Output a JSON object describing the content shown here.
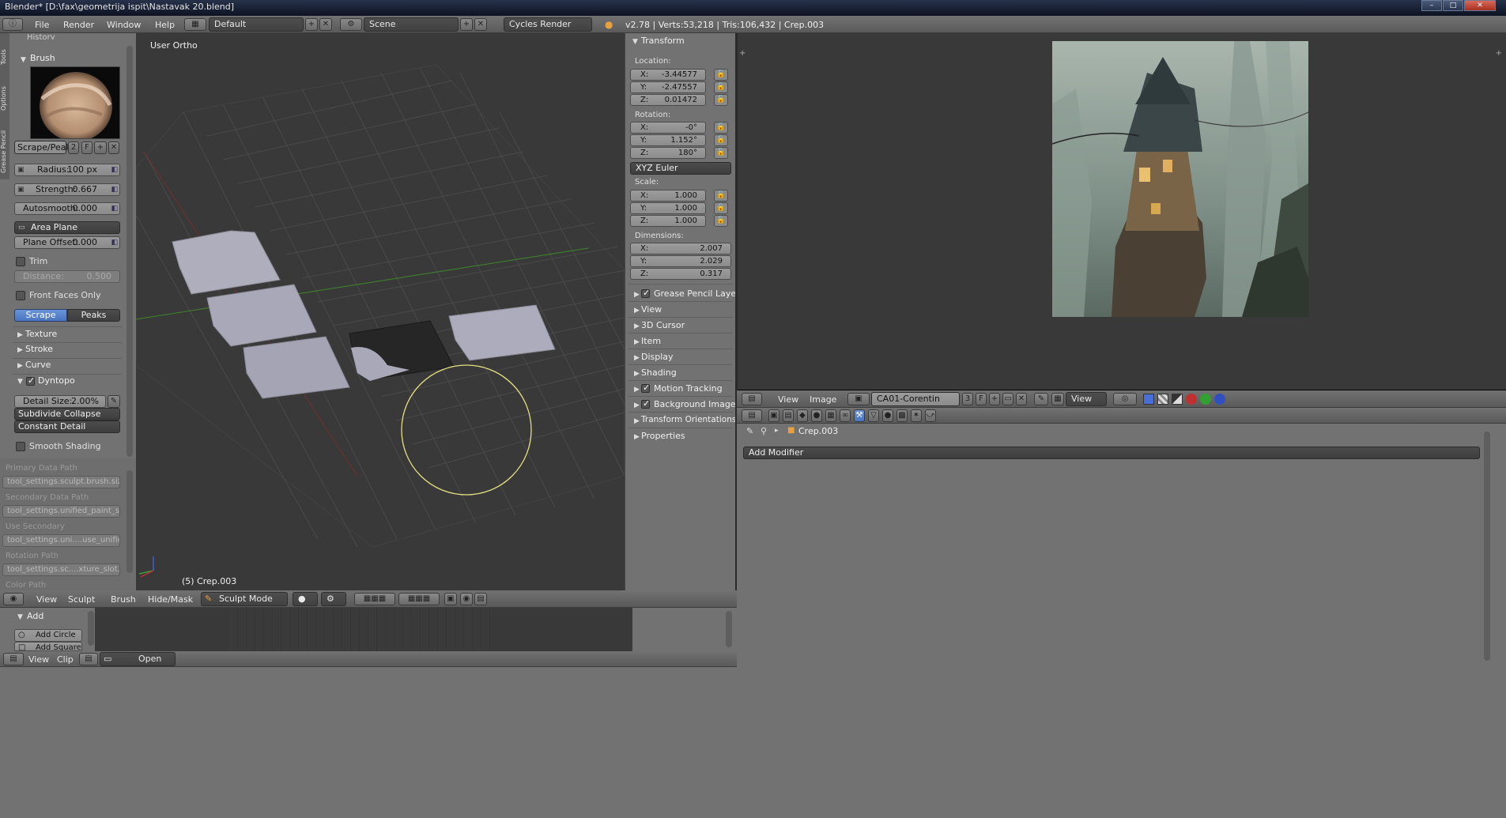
{
  "title": "Blender* [D:\\fax\\geometrija ispit\\Nastavak 20.blend]",
  "info_header": {
    "menus": [
      "File",
      "Render",
      "Window",
      "Help"
    ],
    "screen_layout": "Default",
    "scene": "Scene",
    "render_engine": "Cycles Render",
    "stats": "v2.78 | Verts:53,218 | Tris:106,432 | Crep.003"
  },
  "toolshelf": {
    "tabs": [
      "Tools",
      "Options",
      "Grease Pencil"
    ],
    "history_label": "History",
    "brush_panel": "Brush",
    "brush_name": "Scrape/Peaks",
    "brush_users": "2",
    "brush_fake": "F",
    "radius_label": "Radius:",
    "radius_value": "100 px",
    "strength_label": "Strength:",
    "strength_value": "0.667",
    "autosmooth_label": "Autosmooth:",
    "autosmooth_value": "0.000",
    "area_plane": "Area Plane",
    "plane_offset_label": "Plane Offset:",
    "plane_offset_value": "0.000",
    "trim_label": "Trim",
    "distance_label": "Distance:",
    "distance_value": "0.500",
    "front_faces_label": "Front Faces Only",
    "scrape_label": "Scrape",
    "peaks_label": "Peaks",
    "texture_label": "Texture",
    "stroke_label": "Stroke",
    "curve_label": "Curve",
    "dyntopo_label": "Dyntopo",
    "detail_size_label": "Detail Size:",
    "detail_size_value": "2.00%",
    "subdivide_collapse": "Subdivide Collapse",
    "constant_detail": "Constant Detail",
    "smooth_shading_label": "Smooth Shading",
    "primary_path_label": "Primary Data Path",
    "primary_path_value": "tool_settings.sculpt.brush.size",
    "secondary_path_label": "Secondary Data Path",
    "secondary_path_value": "tool_settings.unified_paint_settin...",
    "use_secondary_label": "Use Secondary",
    "use_secondary_value": "tool_settings.uni....use_unified_size",
    "rotation_path_label": "Rotation Path",
    "rotation_path_value": "tool_settings.sc....xture_slot.angle",
    "color_path_label": "Color Path"
  },
  "viewport": {
    "view_label": "User Ortho",
    "object_label": "(5) Crep.003"
  },
  "npanel": {
    "transform_label": "Transform",
    "location_label": "Location:",
    "location": [
      {
        "axis": "X:",
        "value": "-3.44577"
      },
      {
        "axis": "Y:",
        "value": "-2.47557"
      },
      {
        "axis": "Z:",
        "value": "0.01472"
      }
    ],
    "rotation_label": "Rotation:",
    "rotation": [
      {
        "axis": "X:",
        "value": "-0°"
      },
      {
        "axis": "Y:",
        "value": "1.152°"
      },
      {
        "axis": "Z:",
        "value": "180°"
      }
    ],
    "rotation_mode": "XYZ Euler",
    "scale_label": "Scale:",
    "scale": [
      {
        "axis": "X:",
        "value": "1.000"
      },
      {
        "axis": "Y:",
        "value": "1.000"
      },
      {
        "axis": "Z:",
        "value": "1.000"
      }
    ],
    "dimensions_label": "Dimensions:",
    "dimensions": [
      {
        "axis": "X:",
        "value": "2.007"
      },
      {
        "axis": "Y:",
        "value": "2.029"
      },
      {
        "axis": "Z:",
        "value": "0.317"
      }
    ],
    "panels": [
      "Grease Pencil Layers",
      "View",
      "3D Cursor",
      "Item",
      "Display",
      "Shading",
      "Motion Tracking",
      "Background Images",
      "Transform Orientations",
      "Properties"
    ]
  },
  "image_editor": {
    "menus": [
      "View",
      "Image"
    ],
    "image_name": "CA01-Corentin Che...",
    "image_users": "3",
    "image_fake": "F",
    "view_mode": "View"
  },
  "properties": {
    "breadcrumb_object": "Crep.003",
    "add_modifier": "Add Modifier"
  },
  "view3d_header": {
    "menus": [
      "View",
      "Sculpt",
      "Brush",
      "Hide/Mask"
    ],
    "mode": "Sculpt Mode"
  },
  "clip_editor": {
    "add_panel": "Add",
    "add_circle": "Add Circle",
    "add_square": "Add Square",
    "menus": [
      "View",
      "Clip"
    ],
    "open_label": "Open"
  }
}
